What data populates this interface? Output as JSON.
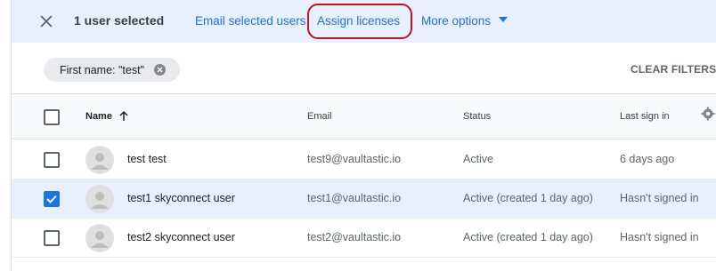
{
  "selection_bar": {
    "count_label": "1 user selected",
    "actions": {
      "email": "Email selected users",
      "assign": "Assign licenses",
      "more": "More options"
    }
  },
  "filter": {
    "chip_label": "First name: \"test\"",
    "clear_label": "CLEAR FILTERS"
  },
  "table": {
    "headers": {
      "name": "Name",
      "email": "Email",
      "status": "Status",
      "last_sign_in": "Last sign in"
    },
    "rows": [
      {
        "name": "test test",
        "email": "test9@vaultastic.io",
        "status": "Active",
        "last_sign_in": "6 days ago",
        "selected": false
      },
      {
        "name": "test1 skyconnect user",
        "email": "test1@vaultastic.io",
        "status": "Active (created 1 day ago)",
        "last_sign_in": "Hasn't signed in",
        "selected": true
      },
      {
        "name": "test2 skyconnect user",
        "email": "test2@vaultastic.io",
        "status": "Active (created 1 day ago)",
        "last_sign_in": "Hasn't signed in",
        "selected": false
      }
    ]
  },
  "colors": {
    "accent": "#1a73e8",
    "selection_bg": "#e8f0fe",
    "highlight_outline": "#c5121c"
  },
  "icons": {
    "close": "close-icon",
    "dropdown": "caret-down-icon",
    "chip_remove": "chip-remove-icon",
    "sort": "sort-ascending-icon",
    "settings": "gear-icon",
    "avatar": "user-avatar-icon"
  }
}
